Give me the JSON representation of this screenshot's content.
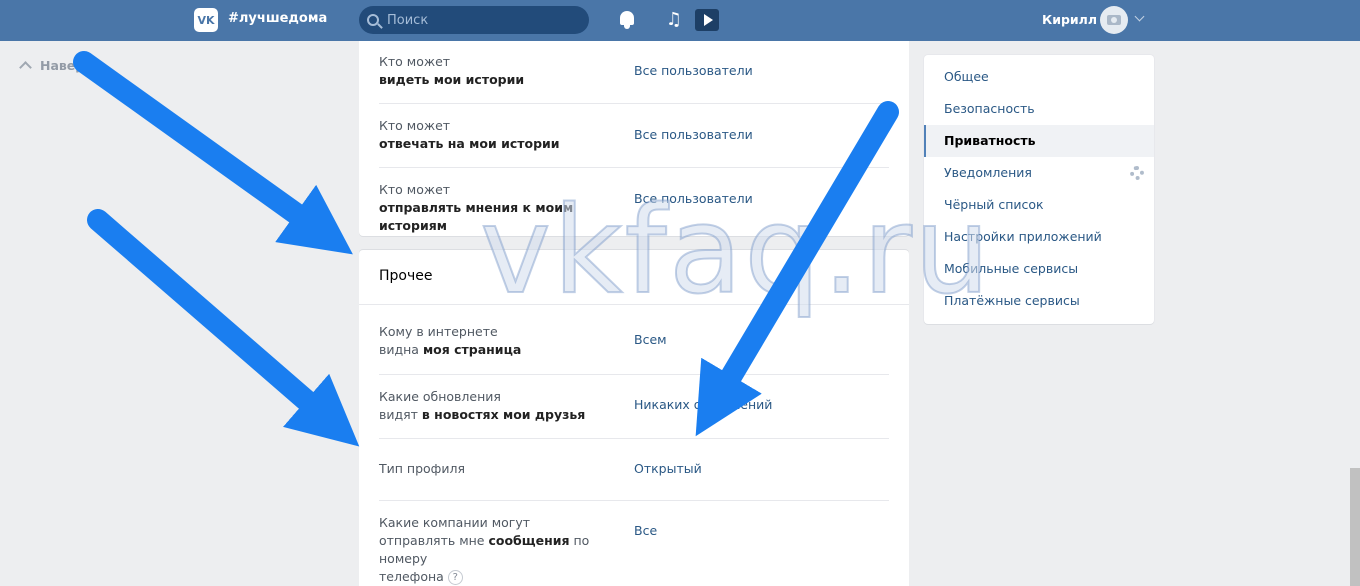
{
  "header": {
    "logo_text": "VK",
    "site_tag": "#лучшедома",
    "search_placeholder": "Поиск",
    "music_glyph": "♫",
    "user_name": "Кирилл"
  },
  "up_link": "Наверх",
  "top_rows": [
    {
      "label_line1": "Кто может",
      "label_line2": "видеть мои истории",
      "value": "Все пользователи"
    },
    {
      "label_line1": "Кто может",
      "label_line2": "отвечать на мои истории",
      "value": "Все пользователи"
    },
    {
      "label_line1": "Кто может",
      "label_line2": "отправлять мнения к моим историям",
      "value": "Все пользователи"
    }
  ],
  "section": {
    "title": "Прочее",
    "rows": [
      {
        "label_a": "Кому в интернете",
        "label_b": "видна ",
        "label_bold": "моя страница",
        "value": "Всем"
      },
      {
        "label_a": "Какие обновления",
        "label_b": "видят ",
        "label_bold": "в новостях мои друзья",
        "value": "Никаких обновлений"
      },
      {
        "label_a": "Тип профиля",
        "value": "Открытый"
      },
      {
        "label_a": "Какие компании могут",
        "label_b": "отправлять мне ",
        "label_bold": "сообщения",
        "label_c": " по номеру",
        "label_d": "телефона",
        "help_glyph": "?",
        "value": "Все"
      }
    ]
  },
  "sidebar": {
    "items": [
      {
        "label": "Общее"
      },
      {
        "label": "Безопасность"
      },
      {
        "label": "Приватность"
      },
      {
        "label": "Уведомления"
      },
      {
        "label": "Чёрный список"
      },
      {
        "label": "Настройки приложений"
      },
      {
        "label": "Мобильные сервисы"
      },
      {
        "label": "Платёжные сервисы"
      }
    ],
    "active_index": 2
  },
  "watermark": "vkfaq.ru",
  "colors": {
    "header": "#4a76a8",
    "link": "#2a5885",
    "arrow": "#1a7ef0"
  }
}
